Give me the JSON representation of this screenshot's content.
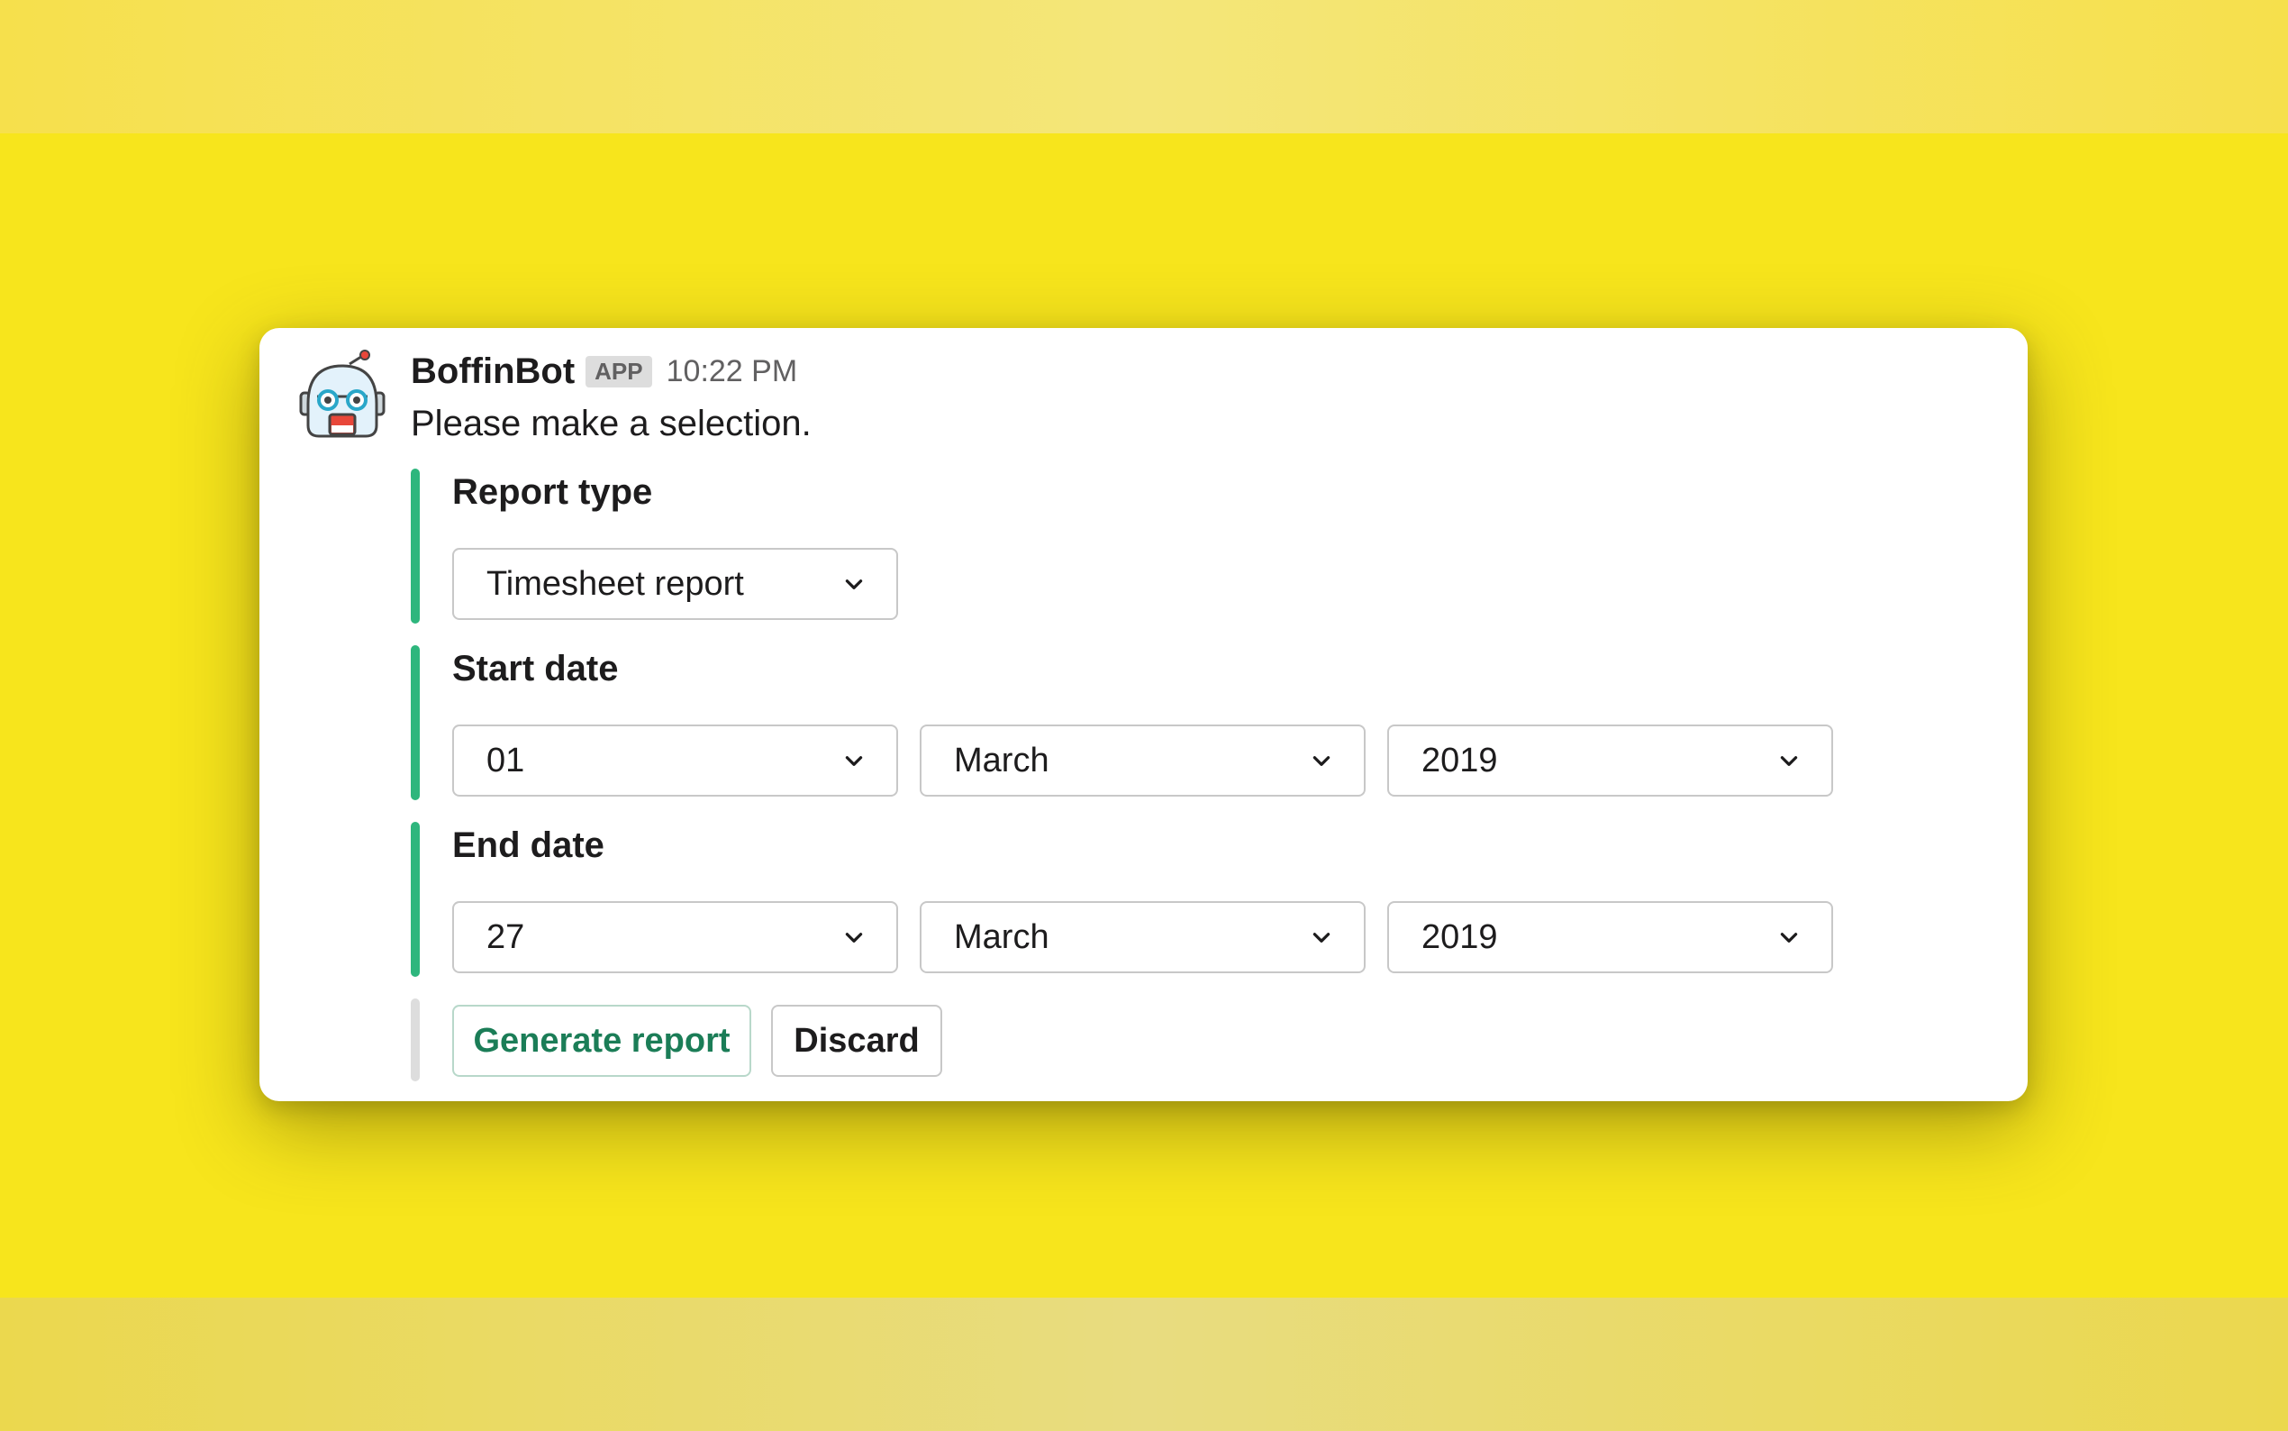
{
  "message": {
    "bot_name": "BoffinBot",
    "app_badge": "APP",
    "timestamp": "10:22 PM",
    "text": "Please make a selection."
  },
  "report_type": {
    "title": "Report type",
    "selected": "Timesheet report"
  },
  "start_date": {
    "title": "Start date",
    "day": "01",
    "month": "March",
    "year": "2019"
  },
  "end_date": {
    "title": "End date",
    "day": "27",
    "month": "March",
    "year": "2019"
  },
  "actions": {
    "generate_label": "Generate report",
    "discard_label": "Discard"
  },
  "colors": {
    "background": "#f7e51c",
    "accent_bar": "#2eb67d",
    "primary_button_text": "#1b7d57"
  },
  "icons": {
    "avatar": "robot-avatar-icon",
    "dropdown": "chevron-down-icon"
  }
}
